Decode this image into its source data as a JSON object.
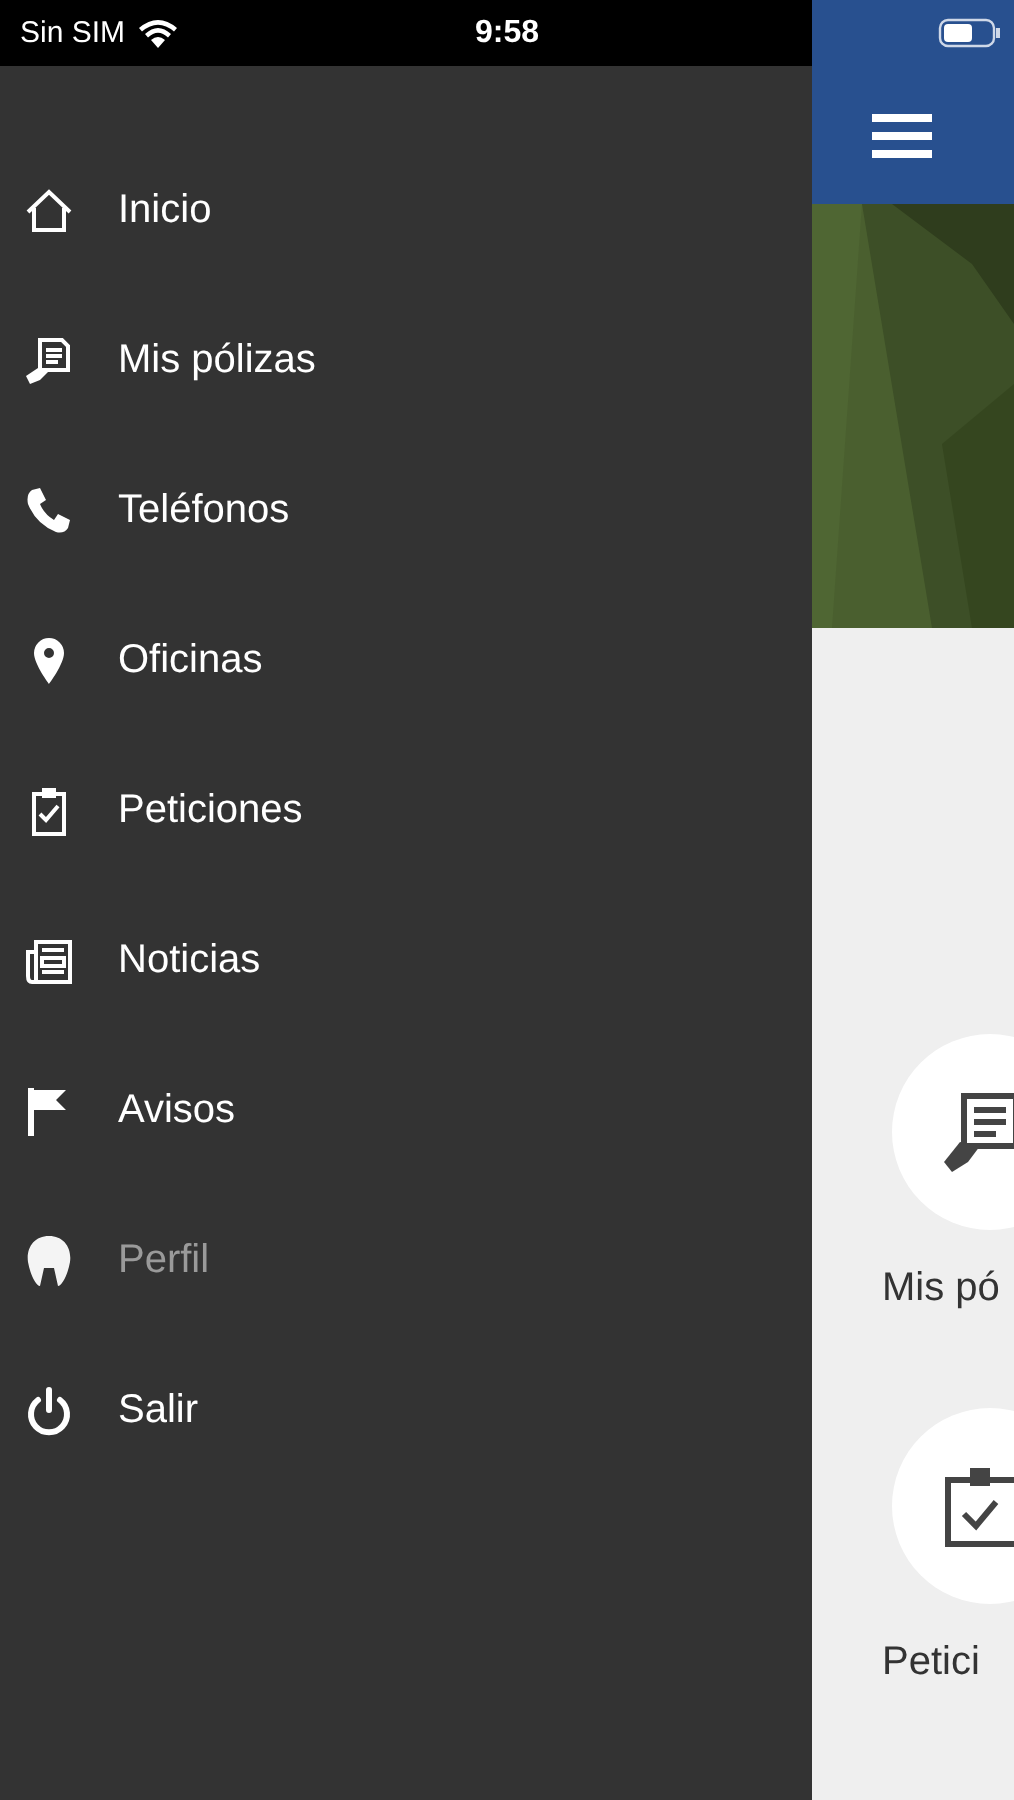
{
  "status_bar": {
    "carrier": "Sin SIM",
    "time": "9:58"
  },
  "drawer": {
    "items": [
      {
        "label": "Inicio",
        "selected": false
      },
      {
        "label": "Mis pólizas",
        "selected": false
      },
      {
        "label": "Teléfonos",
        "selected": false
      },
      {
        "label": "Oficinas",
        "selected": false
      },
      {
        "label": "Peticiones",
        "selected": false
      },
      {
        "label": "Noticias",
        "selected": false
      },
      {
        "label": "Avisos",
        "selected": false
      },
      {
        "label": "Perfil",
        "selected": true
      },
      {
        "label": "Salir",
        "selected": false
      }
    ]
  },
  "main": {
    "tiles": [
      {
        "label": "Mis pó"
      },
      {
        "label": "Petici"
      }
    ]
  }
}
